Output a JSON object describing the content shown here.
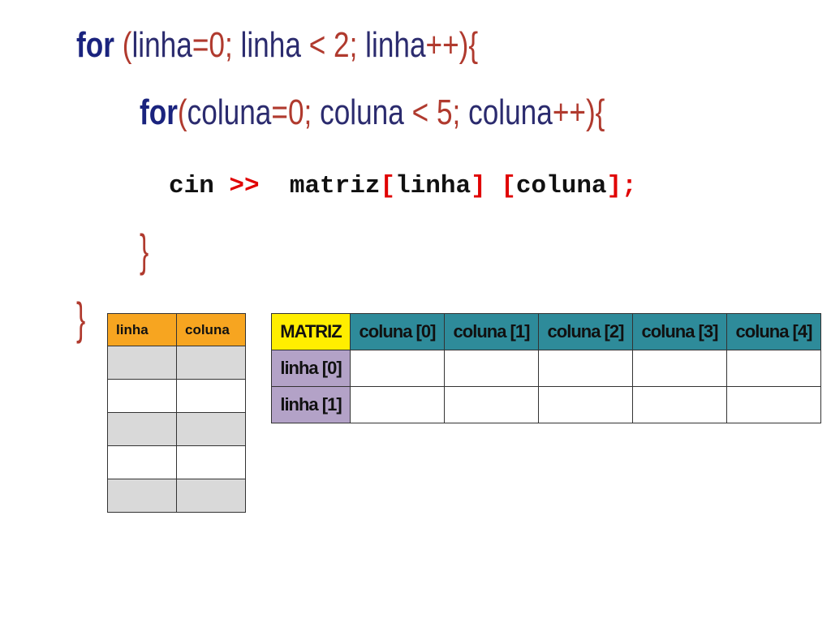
{
  "code": {
    "line1": {
      "keyword": "for",
      "open": "(",
      "text1": "linha",
      "eq": "=",
      "zero": "0",
      "semi1": ";",
      "text2": " linha ",
      "lt": "<",
      "num": " 2",
      "semi2": ";",
      "text3": " linha",
      "inc": "++",
      "close": ")",
      "brace": "{"
    },
    "line2": {
      "keyword": "for",
      "open": "(",
      "text1": "coluna",
      "eq": "=",
      "zero": "0",
      "semi1": ";",
      "text2": " coluna ",
      "lt": "<",
      "num": " 5",
      "semi2": ";",
      "text3": " coluna",
      "inc": "++",
      "close": ")",
      "brace": "{"
    },
    "line3": {
      "cin": "cin ",
      "op": ">>",
      "matrix": "  matriz",
      "b1": "[",
      "linha": "linha",
      "b2": "]",
      "space": " ",
      "b3": "[",
      "coluna": "coluna",
      "b4": "]",
      "semi": ";"
    },
    "close_inner": "}",
    "close_outer": "}"
  },
  "trace_table": {
    "headers": [
      "linha",
      "coluna"
    ],
    "rows": [
      [
        "",
        ""
      ],
      [
        "",
        ""
      ],
      [
        "",
        ""
      ],
      [
        "",
        ""
      ],
      [
        "",
        ""
      ]
    ]
  },
  "matrix_table": {
    "corner": "MATRIZ",
    "columns": [
      "coluna [0]",
      "coluna [1]",
      "coluna [2]",
      "coluna [3]",
      "coluna [4]"
    ],
    "rows": [
      {
        "label": "linha [0]",
        "cells": [
          "",
          "",
          "",
          "",
          ""
        ]
      },
      {
        "label": "linha [1]",
        "cells": [
          "",
          "",
          "",
          "",
          ""
        ]
      }
    ]
  },
  "colors": {
    "trace_header": "#f7a520",
    "matrix_corner": "#ffee00",
    "matrix_column_header": "#2e8b9a",
    "matrix_row_label": "#b3a2c7",
    "trace_gray_row": "#d9d9d9"
  }
}
